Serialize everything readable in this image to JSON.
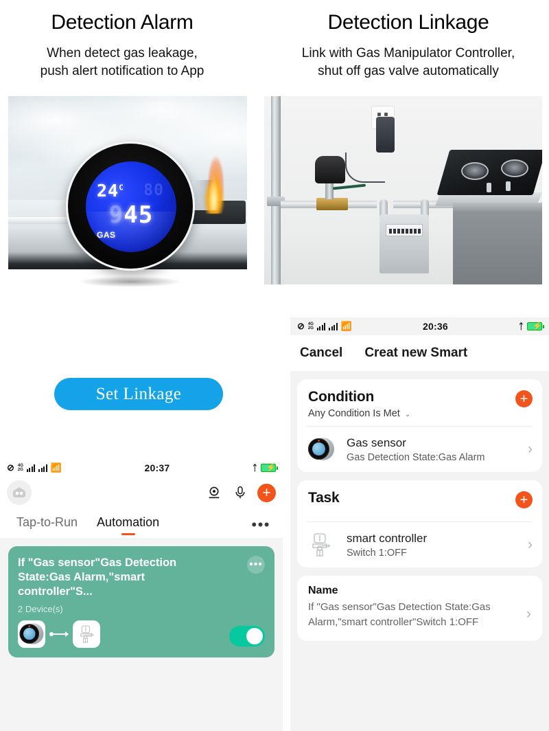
{
  "headings": {
    "left": {
      "title": "Detection Alarm",
      "sub_line1": "When detect gas leakage,",
      "sub_line2": "push alert notification to App"
    },
    "right": {
      "title": "Detection Linkage",
      "sub_line1": "Link with Gas Manipulator Controller,",
      "sub_line2": "shut off gas valve automatically"
    }
  },
  "detector": {
    "temperature": "24",
    "temperature_unit": "C",
    "humidity": "80",
    "reading_dim": "9",
    "reading": "45",
    "label": "GAS"
  },
  "set_linkage_button": "Set Linkage",
  "phone_right": {
    "status": {
      "network": "4G",
      "network2": "2G",
      "time": "20:36"
    },
    "nav": {
      "cancel": "Cancel",
      "title": "Creat new Smart"
    },
    "condition": {
      "heading": "Condition",
      "subtitle": "Any Condition Is Met",
      "chevron": "⌄",
      "add": "+",
      "row": {
        "name": "Gas sensor",
        "detail": "Gas Detection State:Gas Alarm",
        "chevron": "›"
      }
    },
    "task": {
      "heading": "Task",
      "add": "+",
      "row": {
        "name": "smart controller",
        "detail": "Switch 1:OFF",
        "chevron": "›"
      }
    },
    "name": {
      "label": "Name",
      "value": "If \"Gas sensor\"Gas Detection State:Gas Alarm,\"smart controller\"Switch 1:OFF",
      "chevron": "›"
    }
  },
  "phone_left": {
    "status": {
      "network": "4G",
      "network2": "2G",
      "time": "20:37"
    },
    "toolbar": {
      "add": "+"
    },
    "tabs": [
      {
        "label": "Tap-to-Run",
        "active": false
      },
      {
        "label": "Automation",
        "active": true
      }
    ],
    "more": "•••",
    "automation_card": {
      "title": "If \"Gas sensor\"Gas Detection State:Gas Alarm,\"smart controller\"S...",
      "devices_count": "2 Device(s)",
      "menu": "•••",
      "toggle_on": true
    }
  },
  "colors": {
    "accent_orange": "#f2541b",
    "button_blue": "#14a3e8",
    "card_green": "#63b29a",
    "toggle_green": "#06c9a0",
    "panel_bg": "#f3f3f4"
  }
}
